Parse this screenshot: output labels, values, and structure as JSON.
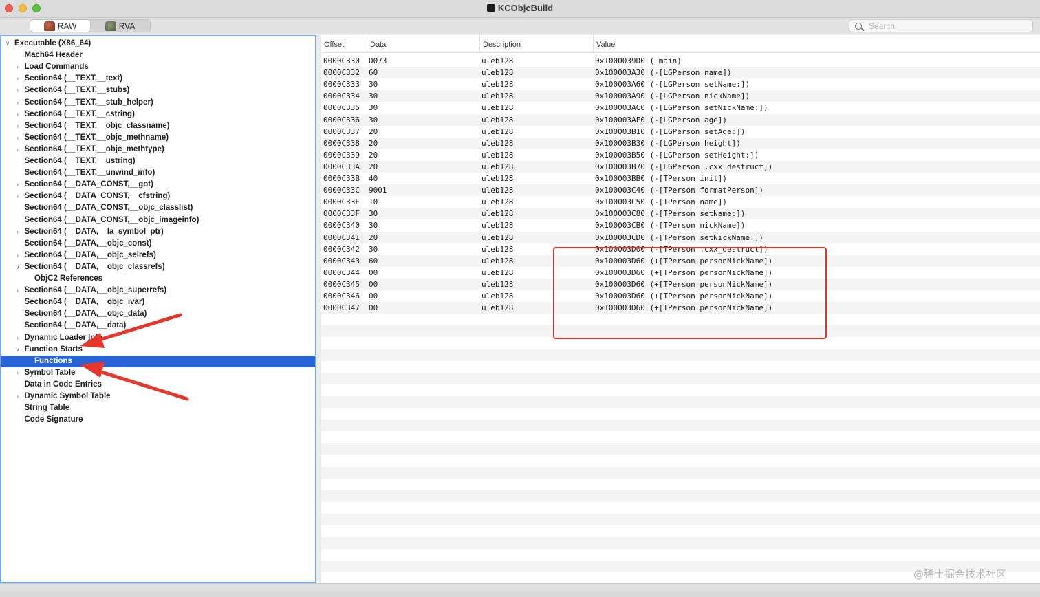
{
  "window": {
    "title": "KCObjcBuild"
  },
  "toolbar": {
    "segments": [
      {
        "label": "RAW",
        "icon": "raw-icon",
        "active": true
      },
      {
        "label": "RVA",
        "icon": "rva-icon",
        "active": false
      }
    ],
    "search_placeholder": "Search"
  },
  "tree": {
    "nodes": [
      {
        "label": "Executable  (X86_64)",
        "indent": 0,
        "arrow": "open"
      },
      {
        "label": "Mach64 Header",
        "indent": 1,
        "arrow": "none"
      },
      {
        "label": "Load Commands",
        "indent": 1,
        "arrow": "closed"
      },
      {
        "label": "Section64 (__TEXT,__text)",
        "indent": 1,
        "arrow": "closed"
      },
      {
        "label": "Section64 (__TEXT,__stubs)",
        "indent": 1,
        "arrow": "closed"
      },
      {
        "label": "Section64 (__TEXT,__stub_helper)",
        "indent": 1,
        "arrow": "closed"
      },
      {
        "label": "Section64 (__TEXT,__cstring)",
        "indent": 1,
        "arrow": "closed"
      },
      {
        "label": "Section64 (__TEXT,__objc_classname)",
        "indent": 1,
        "arrow": "closed"
      },
      {
        "label": "Section64 (__TEXT,__objc_methname)",
        "indent": 1,
        "arrow": "closed"
      },
      {
        "label": "Section64 (__TEXT,__objc_methtype)",
        "indent": 1,
        "arrow": "closed"
      },
      {
        "label": "Section64 (__TEXT,__ustring)",
        "indent": 1,
        "arrow": "none"
      },
      {
        "label": "Section64 (__TEXT,__unwind_info)",
        "indent": 1,
        "arrow": "none"
      },
      {
        "label": "Section64 (__DATA_CONST,__got)",
        "indent": 1,
        "arrow": "closed"
      },
      {
        "label": "Section64 (__DATA_CONST,__cfstring)",
        "indent": 1,
        "arrow": "closed"
      },
      {
        "label": "Section64 (__DATA_CONST,__objc_classlist)",
        "indent": 1,
        "arrow": "none"
      },
      {
        "label": "Section64 (__DATA_CONST,__objc_imageinfo)",
        "indent": 1,
        "arrow": "none"
      },
      {
        "label": "Section64 (__DATA,__la_symbol_ptr)",
        "indent": 1,
        "arrow": "closed"
      },
      {
        "label": "Section64 (__DATA,__objc_const)",
        "indent": 1,
        "arrow": "none"
      },
      {
        "label": "Section64 (__DATA,__objc_selrefs)",
        "indent": 1,
        "arrow": "closed"
      },
      {
        "label": "Section64 (__DATA,__objc_classrefs)",
        "indent": 1,
        "arrow": "open"
      },
      {
        "label": "ObjC2 References",
        "indent": 2,
        "arrow": "none"
      },
      {
        "label": "Section64 (__DATA,__objc_superrefs)",
        "indent": 1,
        "arrow": "closed"
      },
      {
        "label": "Section64 (__DATA,__objc_ivar)",
        "indent": 1,
        "arrow": "none"
      },
      {
        "label": "Section64 (__DATA,__objc_data)",
        "indent": 1,
        "arrow": "none"
      },
      {
        "label": "Section64 (__DATA,__data)",
        "indent": 1,
        "arrow": "none"
      },
      {
        "label": "Dynamic Loader Info",
        "indent": 1,
        "arrow": "closed"
      },
      {
        "label": "Function Starts",
        "indent": 1,
        "arrow": "open"
      },
      {
        "label": "Functions",
        "indent": 2,
        "arrow": "none",
        "selected": true
      },
      {
        "label": "Symbol Table",
        "indent": 1,
        "arrow": "closed"
      },
      {
        "label": "Data in Code Entries",
        "indent": 1,
        "arrow": "none"
      },
      {
        "label": "Dynamic Symbol Table",
        "indent": 1,
        "arrow": "closed"
      },
      {
        "label": "String Table",
        "indent": 1,
        "arrow": "none"
      },
      {
        "label": "Code Signature",
        "indent": 1,
        "arrow": "none"
      }
    ]
  },
  "table": {
    "columns": [
      "Offset",
      "Data",
      "Description",
      "Value"
    ],
    "rows": [
      [
        "0000C330",
        "D073",
        "uleb128",
        "0x1000039D0 (_main)"
      ],
      [
        "0000C332",
        "60",
        "uleb128",
        "0x100003A30 (-[LGPerson name])"
      ],
      [
        "0000C333",
        "30",
        "uleb128",
        "0x100003A60 (-[LGPerson setName:])"
      ],
      [
        "0000C334",
        "30",
        "uleb128",
        "0x100003A90 (-[LGPerson nickName])"
      ],
      [
        "0000C335",
        "30",
        "uleb128",
        "0x100003AC0 (-[LGPerson setNickName:])"
      ],
      [
        "0000C336",
        "30",
        "uleb128",
        "0x100003AF0 (-[LGPerson age])"
      ],
      [
        "0000C337",
        "20",
        "uleb128",
        "0x100003B10 (-[LGPerson setAge:])"
      ],
      [
        "0000C338",
        "20",
        "uleb128",
        "0x100003B30 (-[LGPerson height])"
      ],
      [
        "0000C339",
        "20",
        "uleb128",
        "0x100003B50 (-[LGPerson setHeight:])"
      ],
      [
        "0000C33A",
        "20",
        "uleb128",
        "0x100003B70 (-[LGPerson .cxx_destruct])"
      ],
      [
        "0000C33B",
        "40",
        "uleb128",
        "0x100003BB0 (-[TPerson init])"
      ],
      [
        "0000C33C",
        "9001",
        "uleb128",
        "0x100003C40 (-[TPerson formatPerson])"
      ],
      [
        "0000C33E",
        "10",
        "uleb128",
        "0x100003C50 (-[TPerson name])"
      ],
      [
        "0000C33F",
        "30",
        "uleb128",
        "0x100003C80 (-[TPerson setName:])"
      ],
      [
        "0000C340",
        "30",
        "uleb128",
        "0x100003CB0 (-[TPerson nickName])"
      ],
      [
        "0000C341",
        "20",
        "uleb128",
        "0x100003CD0 (-[TPerson setNickName:])"
      ],
      [
        "0000C342",
        "30",
        "uleb128",
        "0x100003D00 (-[TPerson .cxx_destruct])"
      ],
      [
        "0000C343",
        "60",
        "uleb128",
        "0x100003D60 (+[TPerson personNickName])"
      ],
      [
        "0000C344",
        "00",
        "uleb128",
        "0x100003D60 (+[TPerson personNickName])"
      ],
      [
        "0000C345",
        "00",
        "uleb128",
        "0x100003D60 (+[TPerson personNickName])"
      ],
      [
        "0000C346",
        "00",
        "uleb128",
        "0x100003D60 (+[TPerson personNickName])"
      ],
      [
        "0000C347",
        "00",
        "uleb128",
        "0x100003D60 (+[TPerson personNickName])"
      ]
    ]
  },
  "watermark": "@稀土掘金技术社区",
  "colors": {
    "selection": "#2764d8",
    "annotation": "#e0362a",
    "focus_ring": "#7aa7e8"
  }
}
